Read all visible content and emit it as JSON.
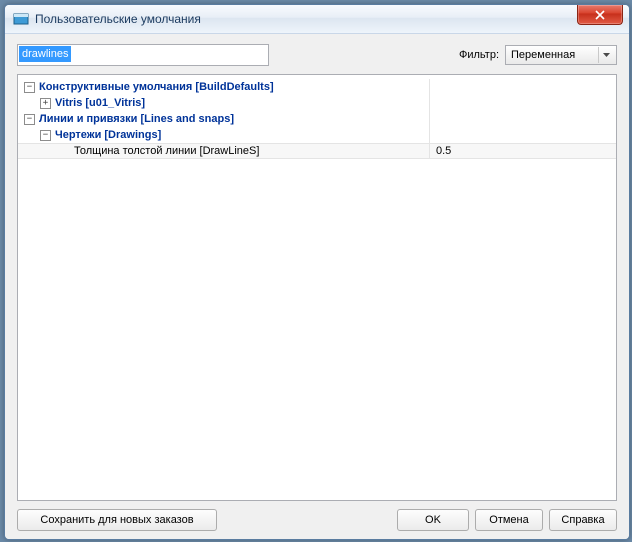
{
  "window": {
    "title": "Пользовательские умолчания"
  },
  "filter": {
    "label": "Фильтр:",
    "value": "Переменная"
  },
  "search": {
    "value": "drawlines"
  },
  "tree": {
    "n1": "Конструктивные умолчания [BuildDefaults]",
    "n2": "Vitris [u01_Vitris]",
    "n3": "Линии и привязки [Lines and snaps]",
    "n4": "Чертежи [Drawings]",
    "n5": "Толщина толстой линии [DrawLineS]",
    "v5": "0.5"
  },
  "buttons": {
    "save": "Сохранить для новых заказов",
    "ok": "OK",
    "cancel": "Отмена",
    "help": "Справка"
  }
}
